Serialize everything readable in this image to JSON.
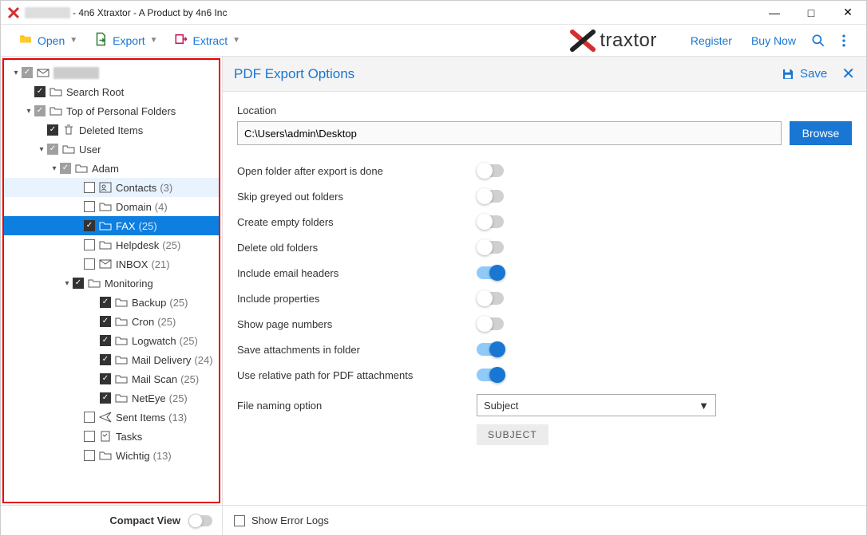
{
  "window": {
    "blurred_user": "james-os",
    "title_suffix": " - 4n6 Xtraxtor - A Product by 4n6 Inc"
  },
  "brand": {
    "x": "X",
    "text": "traxtor"
  },
  "toolbar": {
    "open": "Open",
    "export": "Export",
    "extract": "Extract",
    "register": "Register",
    "buy_now": "Buy Now"
  },
  "sidebar": {
    "compact_view": "Compact View",
    "tree": [
      {
        "id": "root",
        "label": "",
        "blurred": true,
        "indent": 0,
        "caret": "down",
        "checked": "grey",
        "icon": "mailbox"
      },
      {
        "id": "search-root",
        "label": "Search Root",
        "indent": 1,
        "checked": true,
        "icon": "folder"
      },
      {
        "id": "top-personal",
        "label": "Top of Personal Folders",
        "indent": 1,
        "caret": "down",
        "checked": "grey",
        "icon": "folder"
      },
      {
        "id": "deleted",
        "label": "Deleted Items",
        "indent": 2,
        "checked": true,
        "icon": "trash"
      },
      {
        "id": "user",
        "label": "User",
        "indent": 2,
        "caret": "down",
        "checked": "grey",
        "icon": "folder"
      },
      {
        "id": "adam",
        "label": "Adam",
        "indent": 3,
        "caret": "down",
        "checked": "grey",
        "icon": "folder"
      },
      {
        "id": "contacts",
        "label": "Contacts",
        "count": "(3)",
        "indent": 5,
        "checked": false,
        "icon": "contacts",
        "light": true
      },
      {
        "id": "domain",
        "label": "Domain",
        "count": "(4)",
        "indent": 5,
        "checked": false,
        "icon": "folder"
      },
      {
        "id": "fax",
        "label": "FAX",
        "count": "(25)",
        "indent": 5,
        "checked": true,
        "icon": "folder",
        "selected": true
      },
      {
        "id": "helpdesk",
        "label": "Helpdesk",
        "count": "(25)",
        "indent": 5,
        "checked": false,
        "icon": "folder"
      },
      {
        "id": "inbox",
        "label": "INBOX",
        "count": "(21)",
        "indent": 5,
        "checked": false,
        "icon": "mail"
      },
      {
        "id": "monitoring",
        "label": "Monitoring",
        "indent": 4,
        "caret": "down",
        "checked": true,
        "icon": "folder"
      },
      {
        "id": "backup",
        "label": "Backup",
        "count": "(25)",
        "indent": 6,
        "checked": true,
        "icon": "folder"
      },
      {
        "id": "cron",
        "label": "Cron",
        "count": "(25)",
        "indent": 6,
        "checked": true,
        "icon": "folder"
      },
      {
        "id": "logwatch",
        "label": "Logwatch",
        "count": "(25)",
        "indent": 6,
        "checked": true,
        "icon": "folder"
      },
      {
        "id": "mail-delivery",
        "label": "Mail Delivery",
        "count": "(24)",
        "indent": 6,
        "checked": true,
        "icon": "folder"
      },
      {
        "id": "mail-scan",
        "label": "Mail Scan",
        "count": "(25)",
        "indent": 6,
        "checked": true,
        "icon": "folder"
      },
      {
        "id": "neteye",
        "label": "NetEye",
        "count": "(25)",
        "indent": 6,
        "checked": true,
        "icon": "folder"
      },
      {
        "id": "sent",
        "label": "Sent Items",
        "count": "(13)",
        "indent": 5,
        "checked": false,
        "icon": "sent"
      },
      {
        "id": "tasks",
        "label": "Tasks",
        "indent": 5,
        "checked": false,
        "icon": "tasks"
      },
      {
        "id": "wichtig",
        "label": "Wichtig",
        "count": "(13)",
        "indent": 5,
        "checked": false,
        "icon": "folder"
      }
    ]
  },
  "content": {
    "header": "PDF Export Options",
    "save": "Save",
    "location_label": "Location",
    "location_value": "C:\\Users\\admin\\Desktop",
    "browse": "Browse",
    "options": [
      {
        "label": "Open folder after export is done",
        "on": false
      },
      {
        "label": "Skip greyed out folders",
        "on": false
      },
      {
        "label": "Create empty folders",
        "on": false
      },
      {
        "label": "Delete old folders",
        "on": false
      },
      {
        "label": "Include email headers",
        "on": true
      },
      {
        "label": "Include properties",
        "on": false
      },
      {
        "label": "Show page numbers",
        "on": false
      },
      {
        "label": "Save attachments in folder",
        "on": true
      },
      {
        "label": "Use relative path for PDF attachments",
        "on": true
      }
    ],
    "naming_label": "File naming option",
    "naming_value": "Subject",
    "naming_chip": "SUBJECT",
    "footer": {
      "show_error_logs": "Show Error Logs"
    }
  }
}
